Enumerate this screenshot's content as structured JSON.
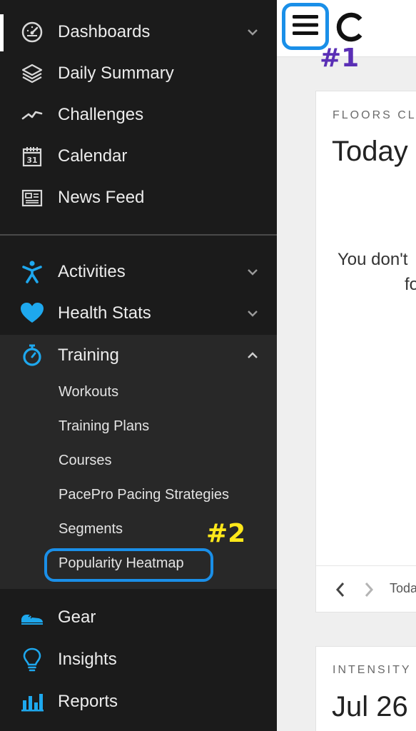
{
  "sidebar": {
    "top_items": [
      {
        "label": "Dashboards",
        "icon": "dashboard-gauge-icon",
        "has_chevron": true,
        "active": true
      },
      {
        "label": "Daily Summary",
        "icon": "layers-icon",
        "has_chevron": false
      },
      {
        "label": "Challenges",
        "icon": "zigzag-line-icon",
        "has_chevron": false
      },
      {
        "label": "Calendar",
        "icon": "calendar-icon",
        "calendar_day": "31",
        "has_chevron": false
      },
      {
        "label": "News Feed",
        "icon": "newspaper-icon",
        "has_chevron": false
      }
    ],
    "bottom_items": [
      {
        "label": "Activities",
        "icon": "person-activity-icon",
        "has_chevron": true
      },
      {
        "label": "Health Stats",
        "icon": "heart-icon",
        "has_chevron": true
      },
      {
        "label": "Training",
        "icon": "stopwatch-icon",
        "has_chevron": true,
        "expanded": true
      },
      {
        "label": "Gear",
        "icon": "shoe-icon",
        "has_chevron": false
      },
      {
        "label": "Insights",
        "icon": "lightbulb-icon",
        "has_chevron": false
      },
      {
        "label": "Reports",
        "icon": "bar-chart-icon",
        "has_chevron": false
      }
    ],
    "training_subitems": [
      {
        "label": "Workouts"
      },
      {
        "label": "Training Plans"
      },
      {
        "label": "Courses"
      },
      {
        "label": "PacePro Pacing Strategies"
      },
      {
        "label": "Segments"
      },
      {
        "label": "Popularity Heatmap",
        "highlighted": true
      }
    ]
  },
  "annotations": {
    "step1": "#1",
    "step2": "#2",
    "step1_color": "#5a2fb5",
    "step2_color": "#ffe81a",
    "highlight_color": "#1a8fe8"
  },
  "main": {
    "card1": {
      "eyebrow": "FLOORS CL",
      "title": "Today",
      "message_line1": "You don't",
      "message_line2": "fo",
      "footer_text": "Toda"
    },
    "card2": {
      "eyebrow": "INTENSITY",
      "title": "Jul 26 -"
    }
  },
  "colors": {
    "sidebar_bg": "#1b1b1b",
    "submenu_bg": "#282828",
    "accent_blue": "#1ea8ee",
    "main_bg": "#efefef"
  }
}
